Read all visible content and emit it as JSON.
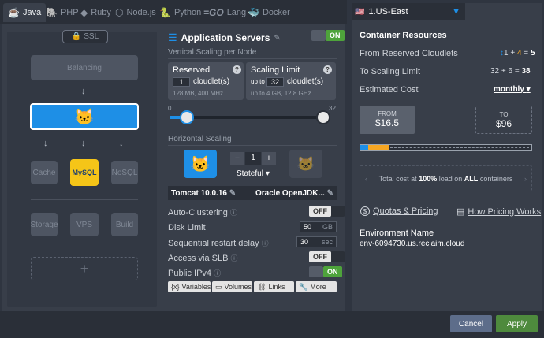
{
  "tabs": [
    {
      "label": "Java",
      "icon": "java-icon",
      "active": true
    },
    {
      "label": "PHP",
      "icon": "php-icon"
    },
    {
      "label": "Ruby",
      "icon": "ruby-icon"
    },
    {
      "label": "Node.js",
      "icon": "nodejs-icon"
    },
    {
      "label": "Python",
      "icon": "python-icon"
    },
    {
      "label": "Lang",
      "icon": "go-icon"
    },
    {
      "label": "Docker",
      "icon": "docker-icon"
    }
  ],
  "topology": {
    "ssl": "SSL",
    "balancing": "Balancing",
    "cache": "Cache",
    "mysql": "MySQL",
    "nosql": "NoSQL",
    "storage": "Storage",
    "vps": "VPS",
    "build": "Build"
  },
  "app_servers": {
    "title": "Application Servers",
    "toggle": "ON",
    "vertical_title": "Vertical Scaling per Node",
    "reserved": {
      "title": "Reserved",
      "value": "1",
      "unit": "cloudlet(s)",
      "spec": "128 MB, 400 MHz"
    },
    "limit": {
      "title": "Scaling Limit",
      "prefix": "up to",
      "value": "32",
      "unit": "cloudlet(s)",
      "spec": "up to 4 GB, 12.8 GHz"
    },
    "slider_min": "0",
    "slider_max": "32",
    "horizontal_title": "Horizontal Scaling",
    "node_count": "1",
    "minus": "−",
    "plus": "+",
    "mode": "Stateful",
    "server_name": "Tomcat 10.0.16",
    "jdk_name": "Oracle OpenJDK...",
    "settings": {
      "auto_clustering": {
        "label": "Auto-Clustering",
        "toggle": "OFF"
      },
      "disk_limit": {
        "label": "Disk Limit",
        "value": "50",
        "unit": "GB"
      },
      "restart_delay": {
        "label": "Sequential restart delay",
        "value": "30",
        "unit": "sec"
      },
      "slb": {
        "label": "Access via SLB",
        "toggle": "OFF"
      },
      "ipv4": {
        "label": "Public IPv4",
        "toggle": "ON"
      }
    },
    "buttons": {
      "variables": "Variables",
      "volumes": "Volumes",
      "links": "Links",
      "more": "More"
    }
  },
  "region": {
    "label": "1.US-East"
  },
  "resources": {
    "title": "Container Resources",
    "reserved_label": "From Reserved Cloudlets",
    "reserved_a": "1",
    "reserved_b": "4",
    "reserved_total": "5",
    "limit_label": "To Scaling Limit",
    "limit_a": "32",
    "limit_b": "6",
    "limit_total": "38",
    "estimated_label": "Estimated Cost",
    "period": "monthly",
    "from_label": "FROM",
    "from_value": "$16.5",
    "to_label": "TO",
    "to_value": "$96",
    "cost_note_1": "Total cost at",
    "cost_note_2": "100%",
    "cost_note_3": "load on",
    "cost_note_4": "ALL",
    "cost_note_5": "containers",
    "quotas_link": "Quotas & Pricing",
    "pricing_link": "How Pricing Works",
    "env_name_label": "Environment Name",
    "env_name": "env-6094730.us.reclaim.cloud"
  },
  "footer": {
    "cancel": "Cancel",
    "apply": "Apply"
  },
  "colors": {
    "accent": "#1e8fe6",
    "on": "#4ea33b",
    "apply": "#4e8a3d",
    "cancel": "#5d6d8a"
  }
}
